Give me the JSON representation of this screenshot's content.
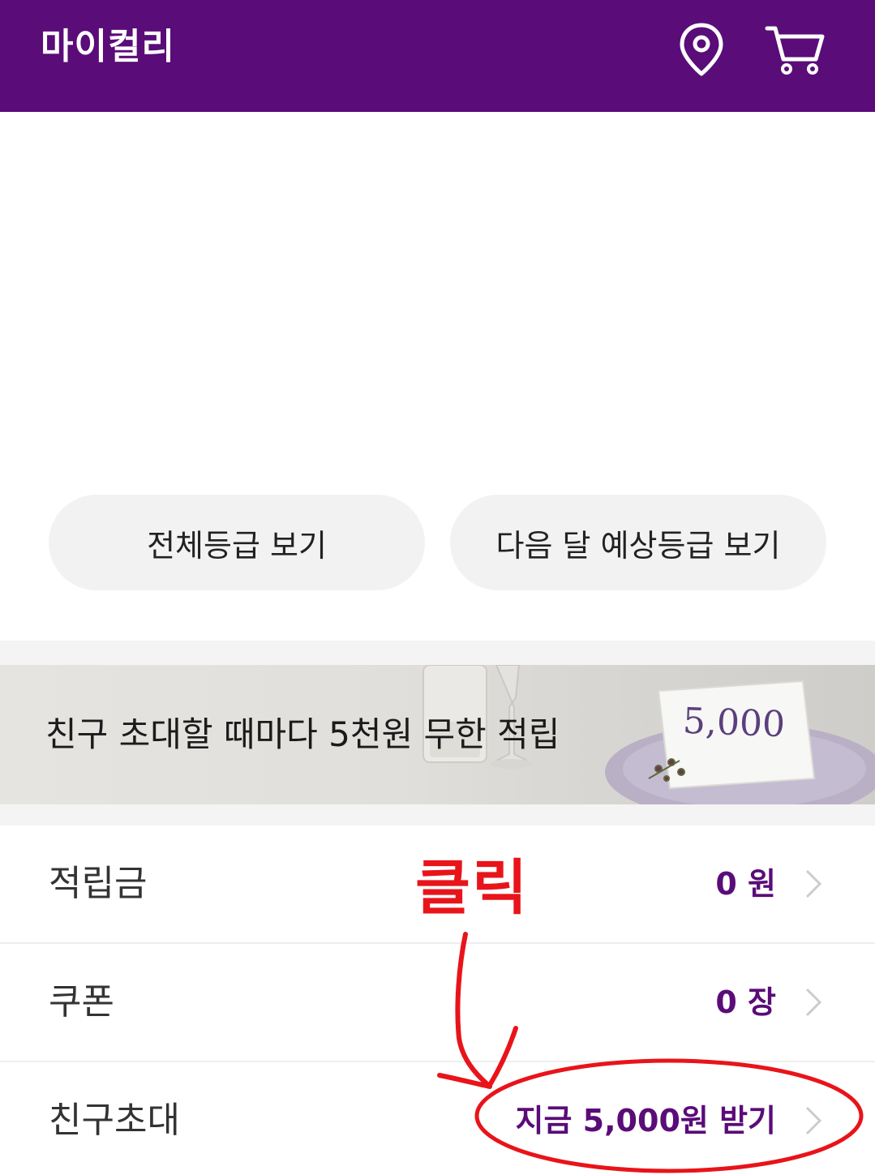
{
  "header": {
    "title": "마이컬리",
    "background": "#5a0c78",
    "icons": [
      "location-pin-icon",
      "cart-icon"
    ]
  },
  "grade_buttons": {
    "all_grades": "전체등급 보기",
    "next_month_grade": "다음 달 예상등급 보기"
  },
  "banner": {
    "text": "친구 초대할 때마다 5천원 무한 적립",
    "card_amount": "5,000"
  },
  "rows": [
    {
      "label": "적립금",
      "value": "0 원"
    },
    {
      "label": "쿠폰",
      "value": "0 장"
    },
    {
      "label": "친구초대",
      "value": "지금 5,000원 받기"
    }
  ],
  "annotation": {
    "text": "클릭",
    "color": "#e8141a"
  },
  "colors": {
    "brand_purple": "#5a0c78",
    "button_bg": "#f2f2f2",
    "chevron": "#cccccc"
  }
}
